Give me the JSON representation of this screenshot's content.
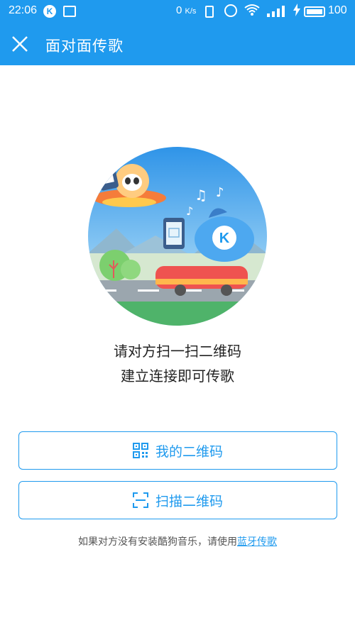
{
  "status_bar": {
    "time": "22:06",
    "speed_value": "0",
    "speed_unit": "K/s",
    "battery": "100"
  },
  "header": {
    "title": "面对面传歌",
    "close_icon": "close-icon"
  },
  "instructions": {
    "line1": "请对方扫一扫二维码",
    "line2": "建立连接即可传歌"
  },
  "buttons": {
    "my_qr": "我的二维码",
    "scan_qr": "扫描二维码"
  },
  "footer": {
    "text": "如果对方没有安装酷狗音乐，请使用",
    "link": "蓝牙传歌"
  },
  "colors": {
    "accent": "#1f9aee"
  }
}
